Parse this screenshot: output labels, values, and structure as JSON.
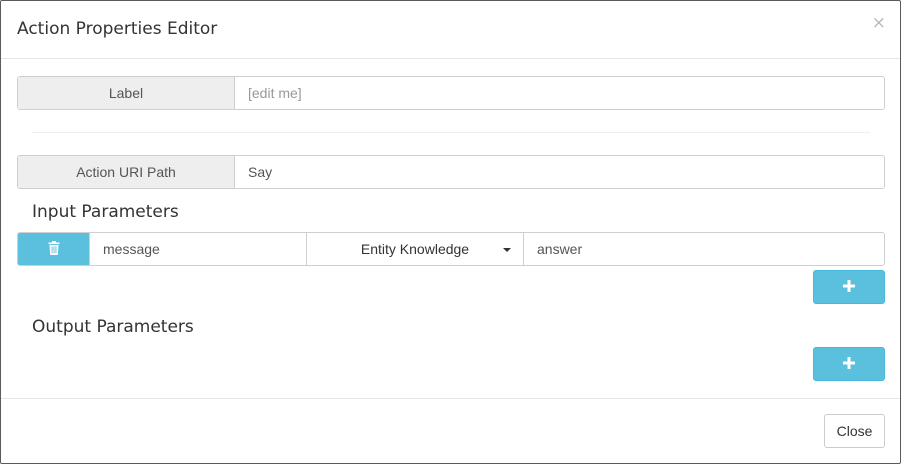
{
  "dialog": {
    "title": "Action Properties Editor",
    "close_glyph": "×"
  },
  "label_row": {
    "label": "Label",
    "value": "",
    "placeholder": "[edit me]"
  },
  "uri_row": {
    "label": "Action URI Path",
    "value": "Say"
  },
  "input_parameters": {
    "title": "Input Parameters",
    "rows": [
      {
        "name": "message",
        "type": "Entity Knowledge",
        "value": "answer"
      }
    ]
  },
  "output_parameters": {
    "title": "Output Parameters",
    "rows": []
  },
  "footer": {
    "close_label": "Close"
  },
  "icons": {
    "delete": "trash-icon",
    "add": "plus-icon",
    "dropdown": "caret-down-icon"
  },
  "colors": {
    "info_button": "#5bc0de",
    "addon_bg": "#eeeeee",
    "border": "#cfcfcf"
  }
}
